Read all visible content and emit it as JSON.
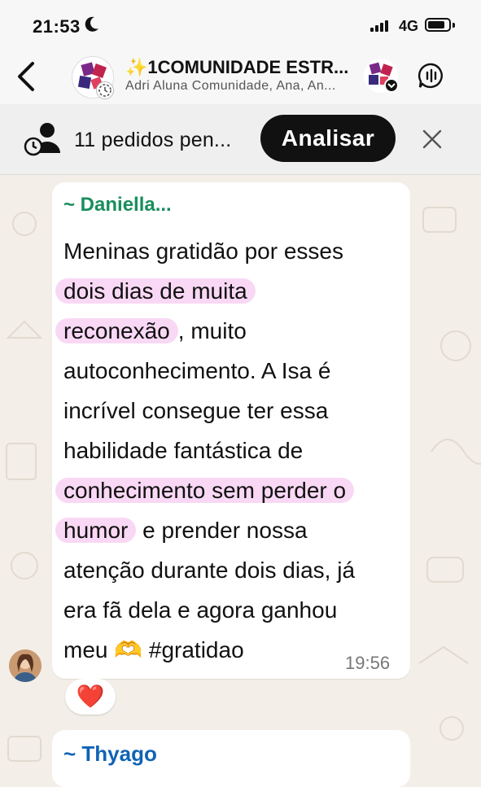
{
  "status_bar": {
    "time": "21:53",
    "moon_icon": "moon-icon",
    "network": "4G"
  },
  "header": {
    "title": "✨1COMUNIDADE ESTR...",
    "subtitle": "Adri Aluna Comunidade, Ana, An..."
  },
  "pending": {
    "text": "11 pedidos pen...",
    "button_label": "Analisar"
  },
  "messages": [
    {
      "sender": "~ Daniella...",
      "sender_color": "#1a8d5f",
      "lines": [
        {
          "text": "Meninas gratidão por esses",
          "highlight_part": "",
          "tail": ""
        },
        {
          "text": "",
          "highlight_part": "dois dias de muita",
          "tail": ""
        },
        {
          "text": "",
          "highlight_part": "reconexão",
          "tail": ", muito"
        },
        {
          "text": "autoconhecimento. A Isa é",
          "highlight_part": "",
          "tail": ""
        },
        {
          "text": "incrível consegue ter essa",
          "highlight_part": "",
          "tail": ""
        },
        {
          "text": "habilidade fantástica de",
          "highlight_part": "",
          "tail": ""
        },
        {
          "text": "",
          "highlight_part": "conhecimento sem perder o",
          "tail": ""
        },
        {
          "text": "",
          "highlight_part": "humor",
          "tail": " e prender nossa"
        },
        {
          "text": "atenção durante dois dias, já",
          "highlight_part": "",
          "tail": ""
        },
        {
          "text": "era fã dela e agora ganhou",
          "highlight_part": "",
          "tail": ""
        },
        {
          "text": "meu 🫶 #gratidao",
          "highlight_part": "",
          "tail": ""
        }
      ],
      "time": "19:56",
      "reaction": "❤️"
    },
    {
      "sender": "~ Thyago",
      "sender_color": "#0f63b5"
    }
  ],
  "colors": {
    "highlight": "#f9d8f5",
    "background": "#f3eee7",
    "header": "#f7f7f7"
  }
}
